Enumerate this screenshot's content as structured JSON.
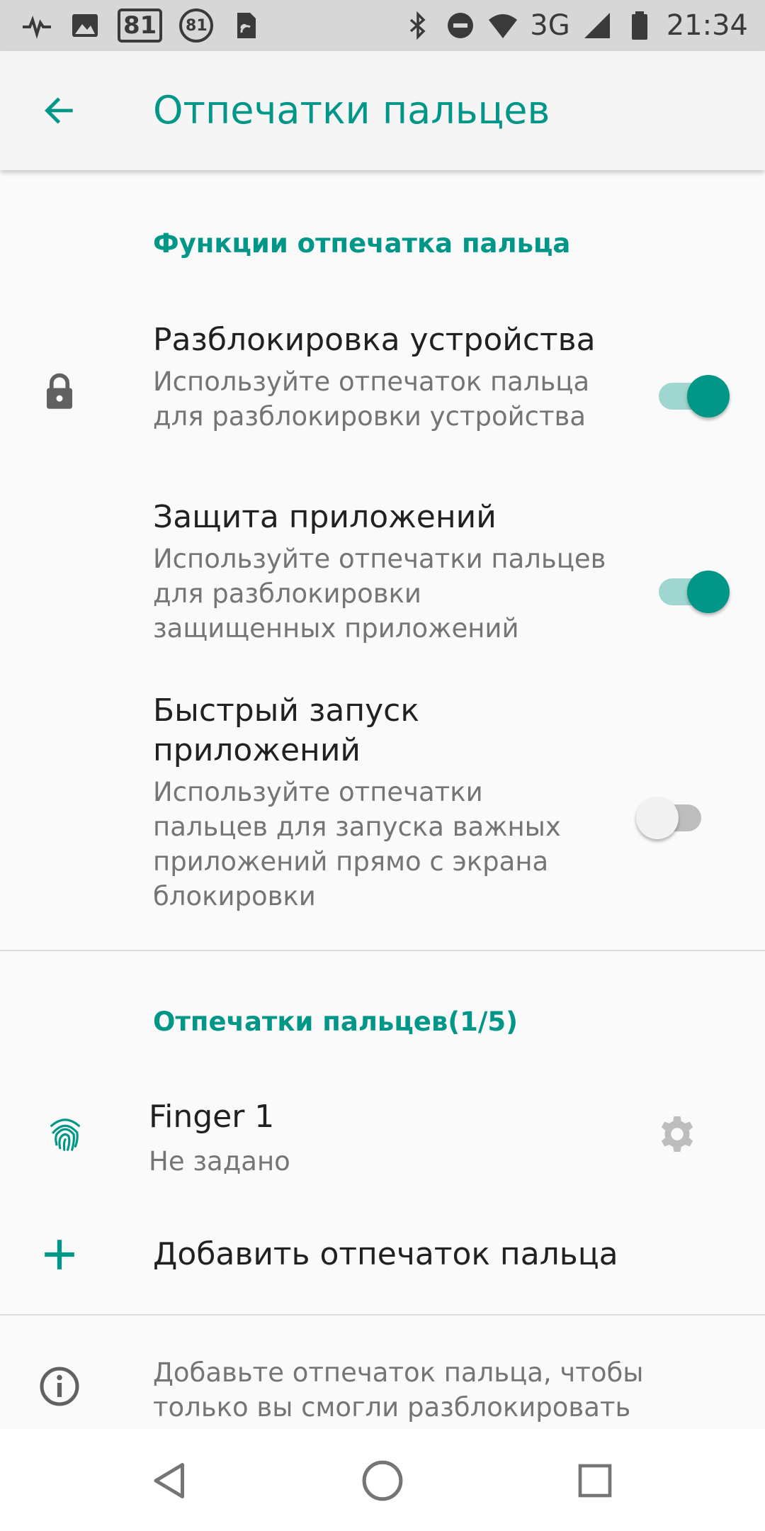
{
  "status_bar": {
    "badge_square": "81",
    "badge_circle": "81",
    "network": "3G",
    "time": "21:34",
    "icons": [
      "pulse-icon",
      "image-icon",
      "badge-81-icon",
      "badge-81-circle-icon",
      "sim-icon",
      "bluetooth-icon",
      "do-not-disturb-icon",
      "wifi-icon",
      "signal-icon",
      "battery-icon"
    ]
  },
  "app_bar": {
    "title": "Отпечатки пальцев"
  },
  "features_section": {
    "header": "Функции отпечатка пальца",
    "items": [
      {
        "title": "Разблокировка устройства",
        "summary": "Используйте отпечаток пальца для разблокировки устройства",
        "enabled": true,
        "icon": "lock-icon"
      },
      {
        "title": "Защита приложений",
        "summary": "Используйте отпечатки пальцев для разблокировки защищенных приложений",
        "enabled": true
      },
      {
        "title": "Быстрый запуск приложений",
        "summary": "Используйте отпечатки пальцев для запуска важных приложений прямо с экрана блокировки",
        "enabled": false
      }
    ]
  },
  "fingerprints_section": {
    "header": "Отпечатки пальцев(1/5)",
    "finger": {
      "title": "Finger 1",
      "summary": "Не задано"
    },
    "add_label": "Добавить отпечаток пальца"
  },
  "info": {
    "text": "Добавьте отпечаток пальца, чтобы только вы смогли разблокировать"
  },
  "colors": {
    "accent": "#009688",
    "status_bar": "#d7d7d7",
    "background": "#fafafa"
  }
}
